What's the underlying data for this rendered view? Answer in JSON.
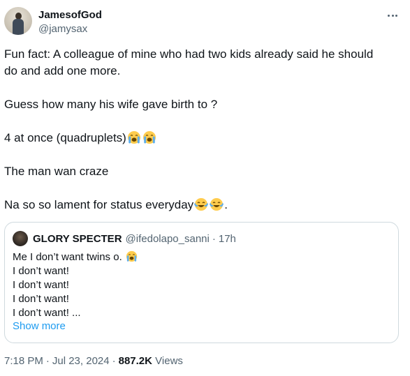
{
  "author": {
    "display_name": "JamesofGod",
    "handle": "@jamysax"
  },
  "more_icon": "more-horizontal-icon",
  "tweet": {
    "line1": "Fun fact: A colleague of mine who had two kids already said he should",
    "line2": "do and add one more.",
    "line3": "Guess how many his wife gave birth to ?",
    "line4": "4 at once (quadruplets)",
    "line5": "The man wan craze",
    "line6": "Na so so lament for status everyday",
    "line6_tail": ".",
    "emojis": {
      "loudly_crying": "loudly-crying-face-icon",
      "tears_of_joy": "face-with-tears-of-joy-icon"
    }
  },
  "quote": {
    "display_name": "GLORY SPECTER",
    "handle": "@ifedolapo_sanni",
    "dot": "·",
    "time": "17h",
    "lines": [
      "Me I don’t want twins o.",
      "I don’t want!",
      "I don’t want!",
      "I don’t want!",
      "I don’t want! ..."
    ],
    "show_more": "Show more"
  },
  "meta": {
    "time": "7:18 PM",
    "sep": "·",
    "date": "Jul 23, 2024",
    "views_count": "887.2K",
    "views_label": "Views"
  },
  "colors": {
    "text": "#0f1419",
    "secondary": "#536471",
    "link": "#1d9bf0",
    "border": "#cfd9de"
  }
}
